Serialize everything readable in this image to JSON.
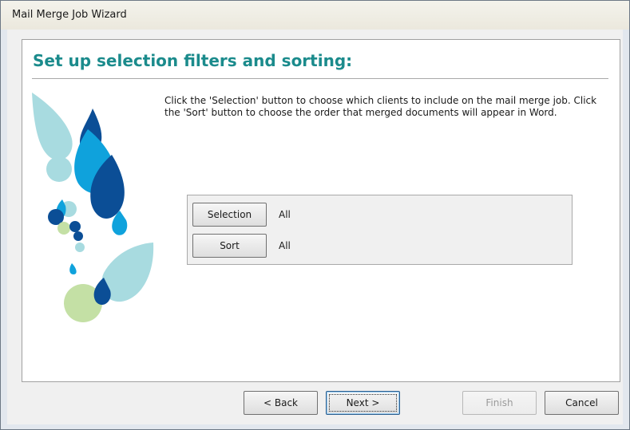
{
  "window": {
    "title": "Mail Merge Job Wizard"
  },
  "page": {
    "heading": "Set up selection filters and sorting:",
    "intro": "Click the 'Selection' button to choose which clients to include on the mail merge job. Click the 'Sort' button to choose the order that merged documents will appear in Word."
  },
  "filters": {
    "selection_label": "Selection",
    "selection_value": "All",
    "sort_label": "Sort",
    "sort_value": "All"
  },
  "footer": {
    "back_label": "< Back",
    "next_label": "Next >",
    "finish_label": "Finish",
    "cancel_label": "Cancel"
  },
  "colors": {
    "heading": "#1b8b8c",
    "art_light_teal": "#a8dbe0",
    "art_cyan": "#0fa2dc",
    "art_navy": "#0b4e96",
    "art_pale_green": "#c4e0a5"
  }
}
